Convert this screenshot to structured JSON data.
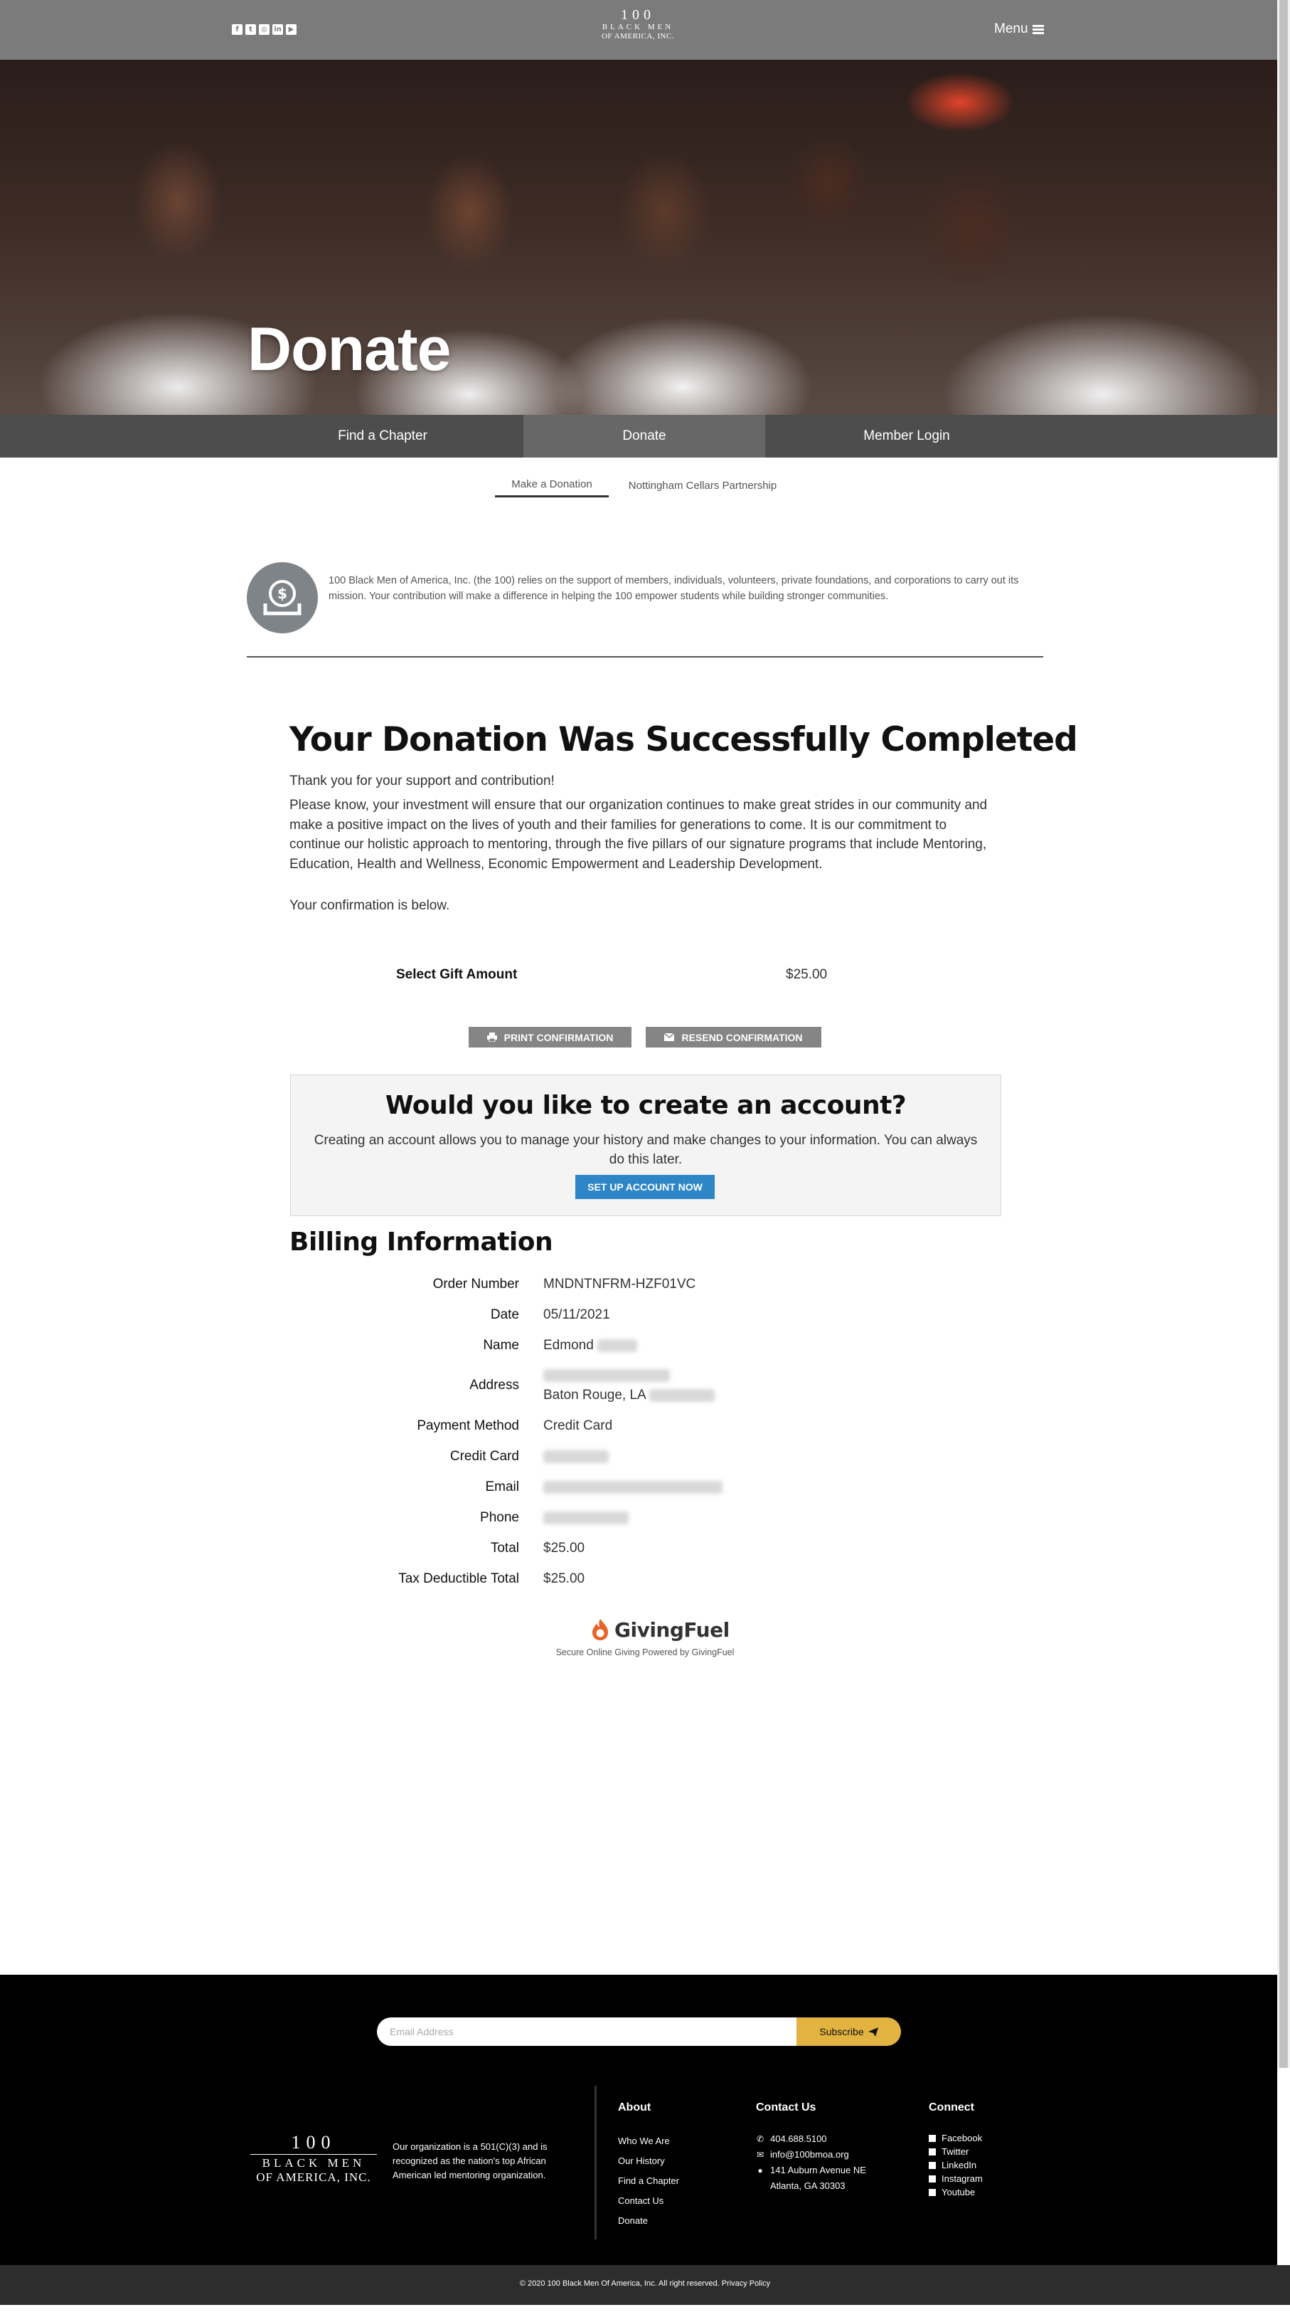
{
  "header": {
    "social_icons": [
      "facebook-icon",
      "twitter-icon",
      "instagram-icon",
      "linkedin-icon",
      "youtube-icon"
    ],
    "logo": {
      "line1": "100",
      "line2": "BLACK MEN",
      "line3": "OF AMERICA, INC."
    },
    "menu_label": "Menu"
  },
  "hero": {
    "title": "Donate"
  },
  "nav": {
    "tabs": [
      {
        "label": "Find a Chapter",
        "active": false
      },
      {
        "label": "Donate",
        "active": true
      },
      {
        "label": "Member Login",
        "active": false
      }
    ],
    "subtabs": [
      {
        "label": "Make a Donation",
        "active": true
      },
      {
        "label": "Nottingham Cellars Partnership",
        "active": false
      }
    ]
  },
  "intro": {
    "text": "100 Black Men of America, Inc. (the 100) relies on the support of members, individuals, volunteers, private foundations, and corporations to carry out its mission. Your contribution will make a difference in helping the 100 empower students while building stronger communities."
  },
  "confirmation": {
    "heading": "Your Donation Was Successfully Completed",
    "thanks": "Thank you for your support and contribution!",
    "paragraph": "Please know, your investment will ensure that our organization continues to make great strides in our community and make a positive impact on the lives of youth and their families for generations to come.  It is our commitment to continue our holistic approach to mentoring, through the five pillars of our signature programs that include Mentoring, Education, Health and Wellness, Economic Empowerment and Leadership Development.",
    "below": "Your confirmation is below.",
    "gift_label": "Select Gift Amount",
    "gift_value": "$25.00",
    "print_label": "PRINT CONFIRMATION",
    "resend_label": "RESEND CONFIRMATION"
  },
  "account": {
    "title": "Would you like to create an account?",
    "text": "Creating an account allows you to manage your history and make changes to your information. You can always do this later.",
    "button": "SET UP ACCOUNT NOW"
  },
  "billing": {
    "heading": "Billing Information",
    "rows": [
      {
        "label": "Order Number",
        "value": "MNDNTNFRM-HZF01VC"
      },
      {
        "label": "Date",
        "value": "05/11/2021"
      },
      {
        "label": "Name",
        "value": "Edmond"
      },
      {
        "label": "Address",
        "value": "Baton Rouge, LA"
      },
      {
        "label": "Payment Method",
        "value": "Credit Card"
      },
      {
        "label": "Credit Card",
        "value": ""
      },
      {
        "label": "Email",
        "value": ""
      },
      {
        "label": "Phone",
        "value": ""
      },
      {
        "label": "Total",
        "value": "$25.00"
      },
      {
        "label": "Tax Deductible Total",
        "value": "$25.00"
      }
    ]
  },
  "givingfuel": {
    "name": "GivingFuel",
    "tagline": "Secure Online Giving Powered by GivingFuel",
    "color": "#e8632a"
  },
  "footer": {
    "newsletter_placeholder": "Email Address",
    "subscribe_label": "Subscribe",
    "logo": {
      "line1": "100",
      "line2": "BLACK MEN",
      "line3": "OF AMERICA, INC."
    },
    "about_text": "Our organization is a 501(C)(3) and is recognized as the nation's top African American led mentoring organization.",
    "about": {
      "title": "About",
      "links": [
        "Who We Are",
        "Our History",
        "Find a Chapter",
        "Contact Us",
        "Donate"
      ]
    },
    "contact": {
      "title": "Contact Us",
      "phone": "404.688.5100",
      "email": "info@100bmoa.org",
      "address1": "141 Auburn Avenue NE",
      "address2": "Atlanta, GA 30303"
    },
    "connect": {
      "title": "Connect",
      "links": [
        "Facebook",
        "Twitter",
        "LinkedIn",
        "Instagram",
        "Youtube"
      ]
    },
    "copyright": "© 2020 100 Black Men Of America, Inc. All right reserved. Privacy Policy"
  },
  "colors": {
    "header_bg": "#7b7b7b",
    "tabs_bg": "#4d4d4d",
    "accent_blue": "#2f86c6",
    "subscribe": "#e2b340"
  }
}
